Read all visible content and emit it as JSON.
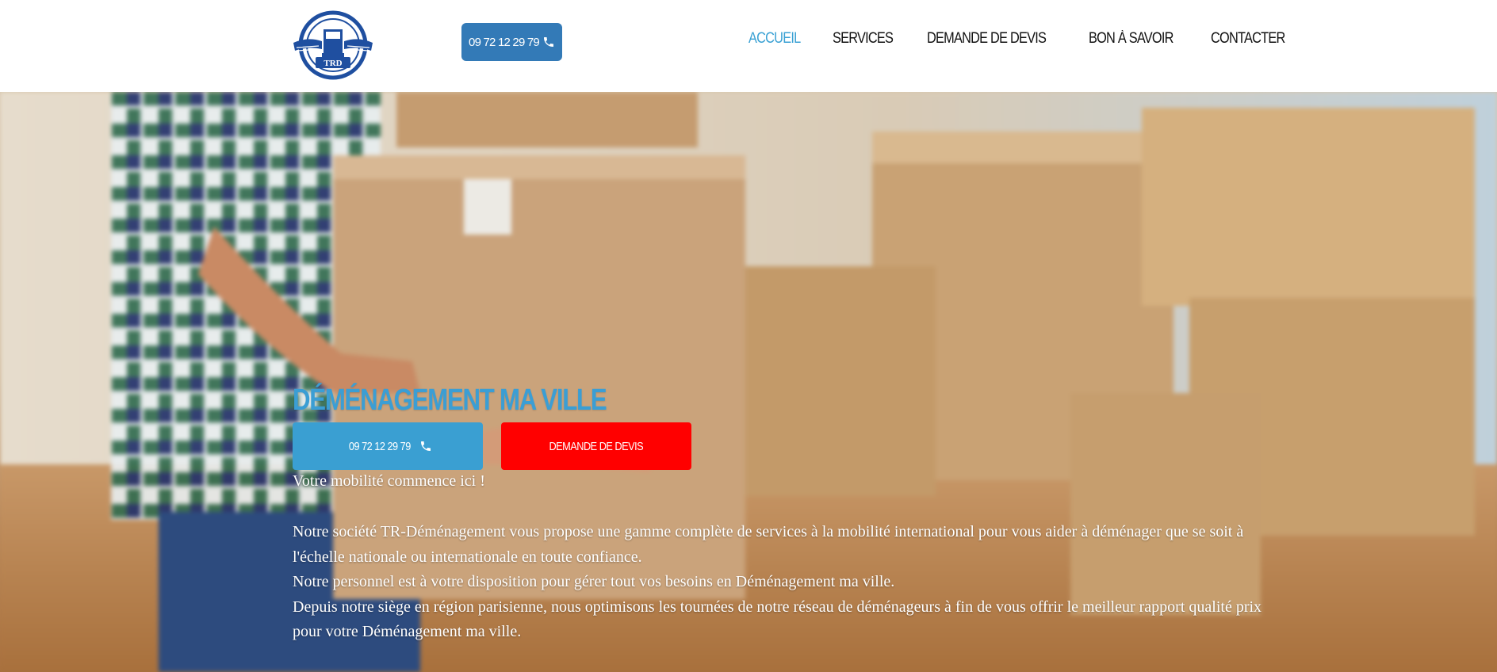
{
  "header": {
    "logo_text": "TRD",
    "phone_label": "09 72 12 29 79",
    "nav": [
      {
        "label": "ACCUEIL",
        "active": true
      },
      {
        "label": "SERVICES",
        "active": false
      },
      {
        "label": "DEMANDE DE DEVIS",
        "active": false
      },
      {
        "label": "BON À SAVOIR",
        "active": false
      },
      {
        "label": "CONTACTER",
        "active": false
      }
    ]
  },
  "hero": {
    "title": "DÉMÉNAGEMENT MA VILLE",
    "phone_button": "09 72 12 29 79",
    "quote_button": "DEMANDE DE DEVIS",
    "tagline": "Votre mobilité commence ici !",
    "paragraphs": [
      "Notre société TR-Déménagement vous propose une gamme complète de services à la mobilité international pour vous aider à déménager que se soit à l'échelle nationale ou internationale en toute confiance.",
      "Notre personnel est à votre disposition pour gérer tout vos besoins en Déménagement ma ville.",
      "Depuis notre siège en région parisienne, nous optimisons les tournées de notre réseau de déménageurs à fin de vous offrir le meilleur rapport qualité prix pour votre Déménagement ma ville."
    ]
  },
  "colors": {
    "brand_blue": "#337ab7",
    "accent_blue": "#3aa1d4",
    "quote_red": "#ff0000"
  },
  "icons": {
    "phone": "phone-icon",
    "logo": "truck-wings-logo"
  }
}
